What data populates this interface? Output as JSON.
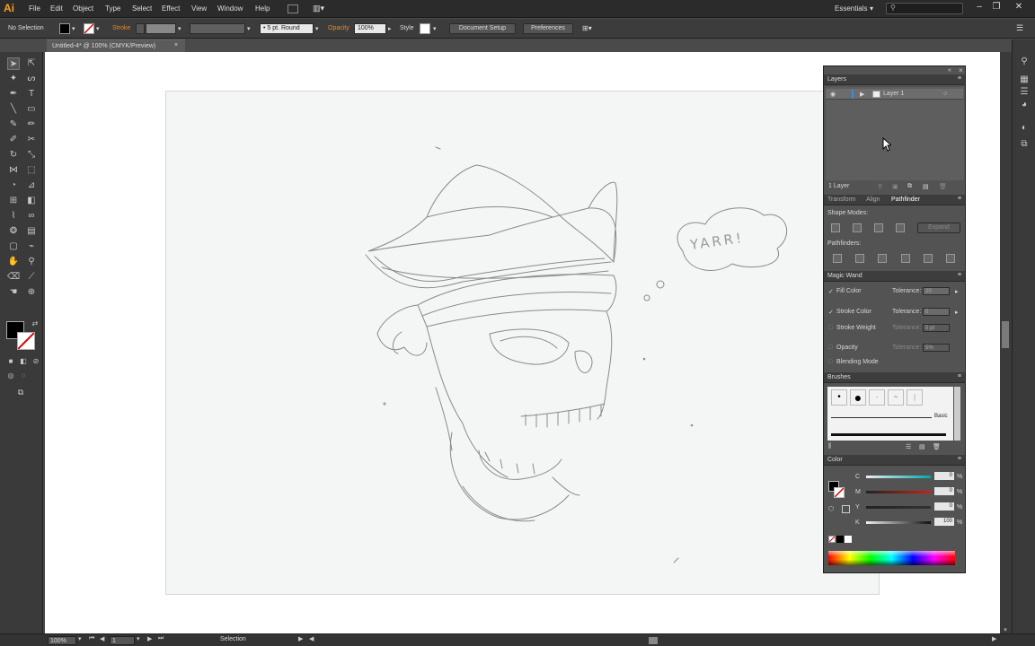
{
  "app": {
    "logo": "Ai"
  },
  "menu": [
    "File",
    "Edit",
    "Object",
    "Type",
    "Select",
    "Effect",
    "View",
    "Window",
    "Help"
  ],
  "workspace": "Essentials",
  "control_bar": {
    "selection": "No Selection",
    "stroke_label": "Stroke",
    "brush": "5 pt. Round",
    "opacity_label": "Opacity",
    "opacity": "100%",
    "style_label": "Style",
    "document_setup": "Document Setup",
    "preferences": "Preferences"
  },
  "document_tab": {
    "title": "Untitled-4* @ 100% (CMYK/Preview)",
    "close": "×"
  },
  "sketch_text": "YARR!",
  "layers_panel": {
    "title": "Layers",
    "layer_name": "Layer 1",
    "count": "1 Layer"
  },
  "pathfinder_panel": {
    "tabs": [
      "Transform",
      "Align",
      "Pathfinder"
    ],
    "shape_modes": "Shape Modes:",
    "pathfinders": "Pathfinders:",
    "expand": "Expand"
  },
  "magic_wand": {
    "title": "Magic Wand",
    "rows": [
      {
        "label": "Fill Color",
        "checked": true,
        "tol_label": "Tolerance:",
        "value": "20"
      },
      {
        "label": "Stroke Color",
        "checked": true,
        "tol_label": "Tolerance:",
        "value": "0"
      },
      {
        "label": "Stroke Weight",
        "checked": false,
        "tol_label": "Tolerance:",
        "value": "5 pt"
      },
      {
        "label": "Opacity",
        "checked": false,
        "tol_label": "Tolerance:",
        "value": "5%"
      },
      {
        "label": "Blending Mode",
        "checked": false
      }
    ]
  },
  "brushes_panel": {
    "title": "Brushes",
    "basic": "Basic"
  },
  "color_panel": {
    "title": "Color",
    "channels": [
      {
        "name": "C",
        "value": "0"
      },
      {
        "name": "M",
        "value": "0"
      },
      {
        "name": "Y",
        "value": "0"
      },
      {
        "name": "K",
        "value": "100"
      }
    ],
    "unit": "%"
  },
  "status_bar": {
    "zoom": "100%",
    "page": "1",
    "tool": "Selection"
  }
}
